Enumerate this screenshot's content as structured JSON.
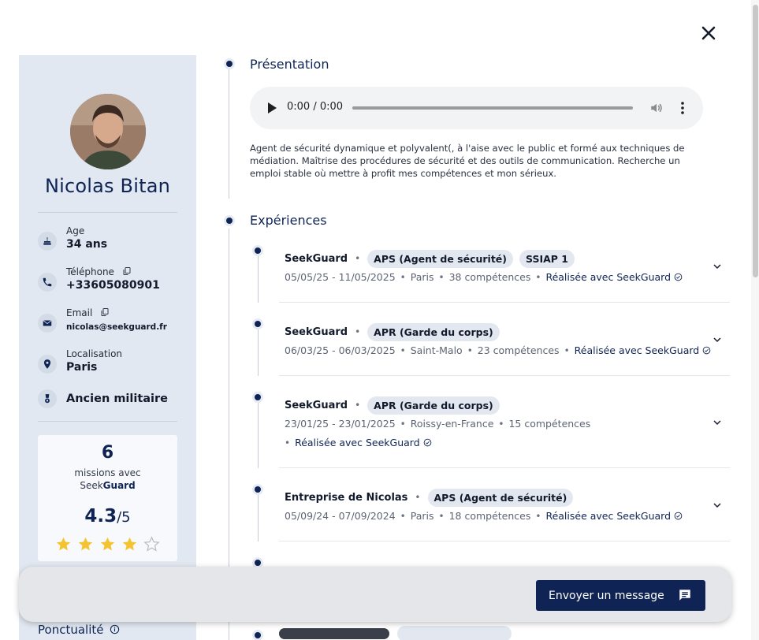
{
  "profile": {
    "name": "Nicolas Bitan",
    "age_label": "Age",
    "age_value": "34 ans",
    "phone_label": "Téléphone",
    "phone_value": "+33605080901",
    "email_label": "Email",
    "email_value": "nicolas@seekguard.fr",
    "location_label": "Localisation",
    "location_value": "Paris",
    "veteran_label": "Ancien militaire"
  },
  "stats": {
    "missions_count": "6",
    "missions_line1": "missions avec",
    "brand_prefix": "Seek",
    "brand_suffix": "Guard",
    "rating_value": "4.3",
    "rating_max": "/5",
    "stars_filled": 4,
    "stars_total": 5
  },
  "ponctualite_label": "Ponctualité",
  "presentation": {
    "title": "Présentation",
    "audio_time": "0:00 / 0:00",
    "description": "Agent de sécurité dynamique et polyvalent(, à l'aise avec le public et formé aux techniques de médiation. Maîtrise des procédures de sécurité et des outils de communication. Recherche un emploi stable où mettre à profit mes compétences et mon sérieux."
  },
  "experiences": {
    "title": "Expériences",
    "items": [
      {
        "company": "SeekGuard",
        "tags": [
          "APS (Agent de sécurité)",
          "SSIAP 1"
        ],
        "dates": "05/05/25 - 11/05/2025",
        "city": "Paris",
        "skills": "38 compétences",
        "done": "Réalisée avec SeekGuard"
      },
      {
        "company": "SeekGuard",
        "tags": [
          "APR (Garde du corps)"
        ],
        "dates": "06/03/25 - 06/03/2025",
        "city": "Saint-Malo",
        "skills": "23 compétences",
        "done": "Réalisée avec SeekGuard"
      },
      {
        "company": "SeekGuard",
        "tags": [
          "APR (Garde du corps)"
        ],
        "dates": "23/01/25 - 23/01/2025",
        "city": "Roissy-en-France",
        "skills": "15 compétences",
        "done": "Réalisée avec SeekGuard"
      },
      {
        "company": "Entreprise de Nicolas",
        "tags": [
          "APS (Agent de sécurité)"
        ],
        "dates": "05/09/24 - 07/09/2024",
        "city": "Paris",
        "skills": "18 compétences",
        "done": "Réalisée avec SeekGuard"
      }
    ]
  },
  "footer": {
    "send_label": "Envoyer un message"
  },
  "icons": {
    "close": "close-icon",
    "age": "cake-icon",
    "phone": "phone-icon",
    "email": "mail-icon",
    "location": "location-pin-icon",
    "veteran": "medal-icon",
    "copy": "copy-icon",
    "star": "star-icon",
    "info": "info-icon",
    "chevron": "chevron-down-icon",
    "verified": "check-circle-icon",
    "chat": "chat-icon"
  },
  "colors": {
    "primary": "#0f2454",
    "sidebar_bg": "#e2e8f1",
    "chip_bg": "#e3e8f0",
    "star": "#f4c430"
  }
}
